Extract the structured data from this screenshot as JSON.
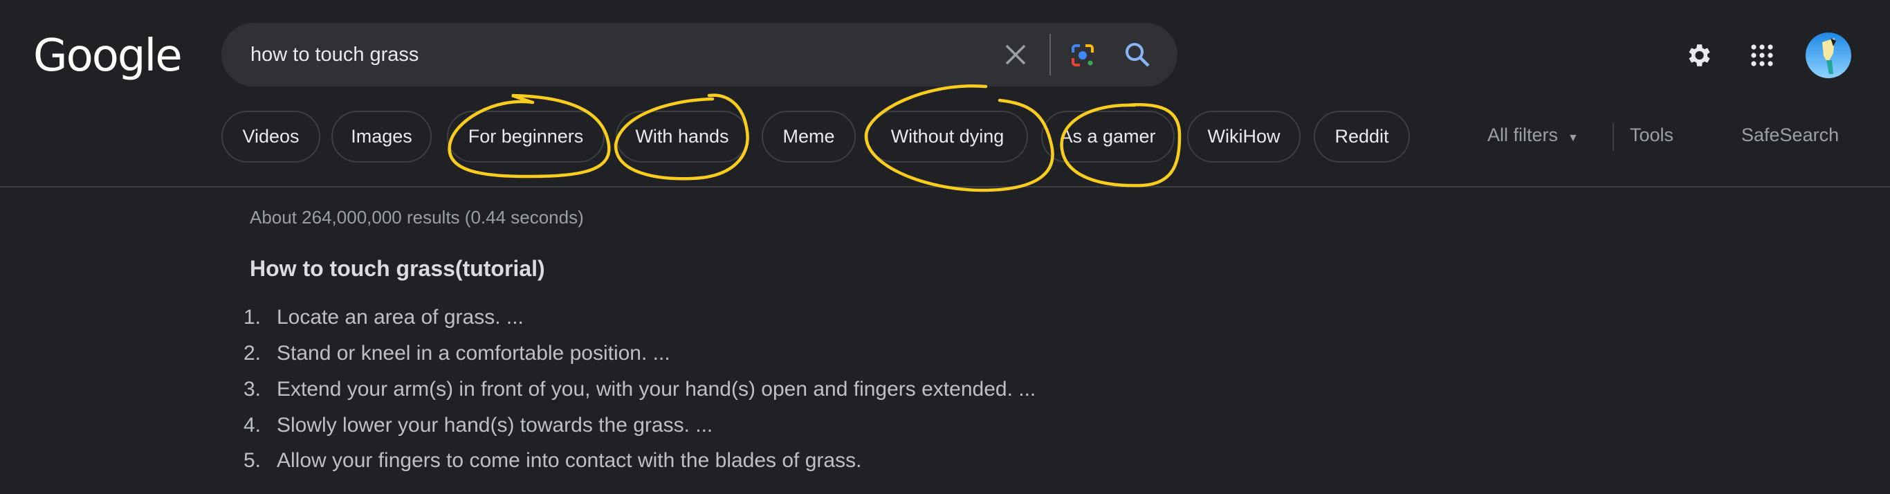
{
  "header": {
    "logo": "Google",
    "search": {
      "query": "how to touch grass"
    },
    "icons": [
      "close-icon",
      "google-lens-icon",
      "search-icon",
      "settings-gear-icon",
      "apps-grid-icon",
      "avatar"
    ]
  },
  "chips": [
    "Videos",
    "Images",
    "For beginners",
    "With hands",
    "Meme",
    "Without dying",
    "As a gamer",
    "WikiHow",
    "Reddit"
  ],
  "tools": {
    "all_filters": "All filters",
    "tools": "Tools",
    "safesearch": "SafeSearch"
  },
  "results": {
    "stats": "About 264,000,000 results (0.44 seconds)",
    "heading": "How to touch grass(tutorial)",
    "steps": [
      {
        "n": "1.",
        "text": "Locate an area of grass. ..."
      },
      {
        "n": "2.",
        "text": "Stand or kneel in a comfortable position. ..."
      },
      {
        "n": "3.",
        "text": "Extend your arm(s) in front of you, with your hand(s) open and fingers extended. ..."
      },
      {
        "n": "4.",
        "text": "Slowly lower your hand(s) towards the grass. ..."
      },
      {
        "n": "5.",
        "text": "Allow your fingers to come into contact with the blades of grass."
      }
    ]
  },
  "colors": {
    "background": "#202124",
    "search_bg": "#303134",
    "annotation": "#f9cd1d",
    "search_icon": "#8ab4f8"
  }
}
